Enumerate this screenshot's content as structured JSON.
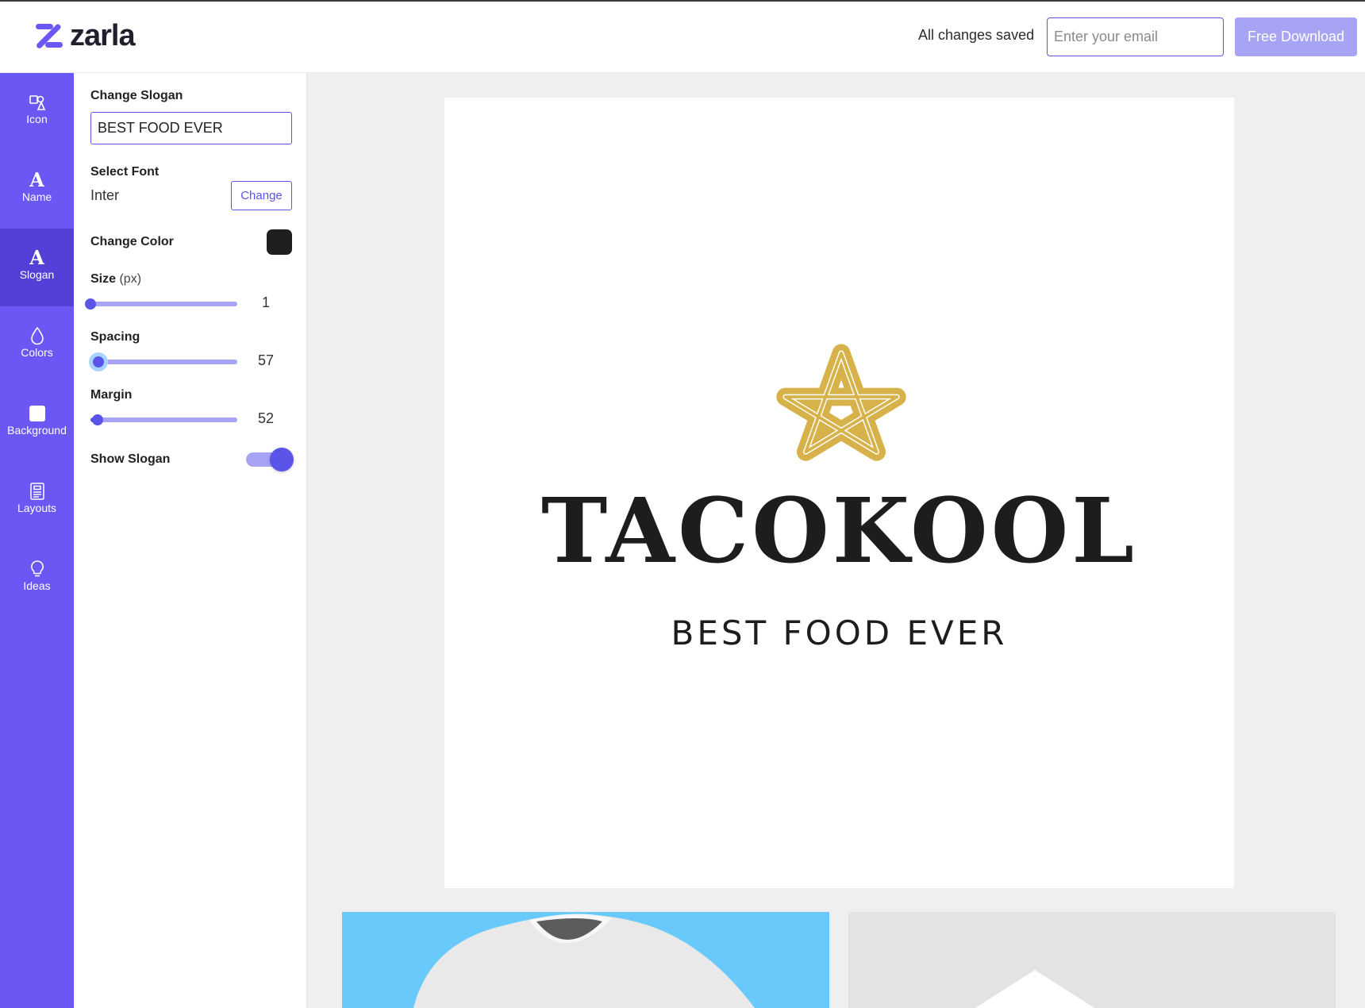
{
  "app": {
    "brand": "zarla",
    "brand_color": "#6b57f3"
  },
  "header": {
    "save_status": "All changes saved",
    "email_placeholder": "Enter your email",
    "email_value": "",
    "download_label": "Free Download"
  },
  "rail": {
    "items": [
      {
        "label": "Icon",
        "icon": "icon-shapes-icon"
      },
      {
        "label": "Name",
        "icon": "letter-a-icon"
      },
      {
        "label": "Slogan",
        "icon": "letter-a-icon",
        "active": true
      },
      {
        "label": "Colors",
        "icon": "drop-icon"
      },
      {
        "label": "Background",
        "icon": "square-icon"
      },
      {
        "label": "Layouts",
        "icon": "layout-icon"
      },
      {
        "label": "Ideas",
        "icon": "lightbulb-icon"
      }
    ]
  },
  "panel": {
    "slogan_label": "Change Slogan",
    "slogan_value": "BEST FOOD EVER",
    "font_label": "Select Font",
    "font_value": "Inter",
    "font_change": "Change",
    "color_label": "Change Color",
    "color_value": "#1f1f1f",
    "size_label": "Size",
    "size_unit": "(px)",
    "size_value": "1",
    "spacing_label": "Spacing",
    "spacing_value": "57",
    "margin_label": "Margin",
    "margin_value": "52",
    "show_label": "Show Slogan",
    "show_on": true
  },
  "preview": {
    "brand_name": "TACOKOOL",
    "slogan": "BEST FOOD EVER",
    "emblem_color": "#d7b24b",
    "text_color": "#1d1d1d"
  }
}
